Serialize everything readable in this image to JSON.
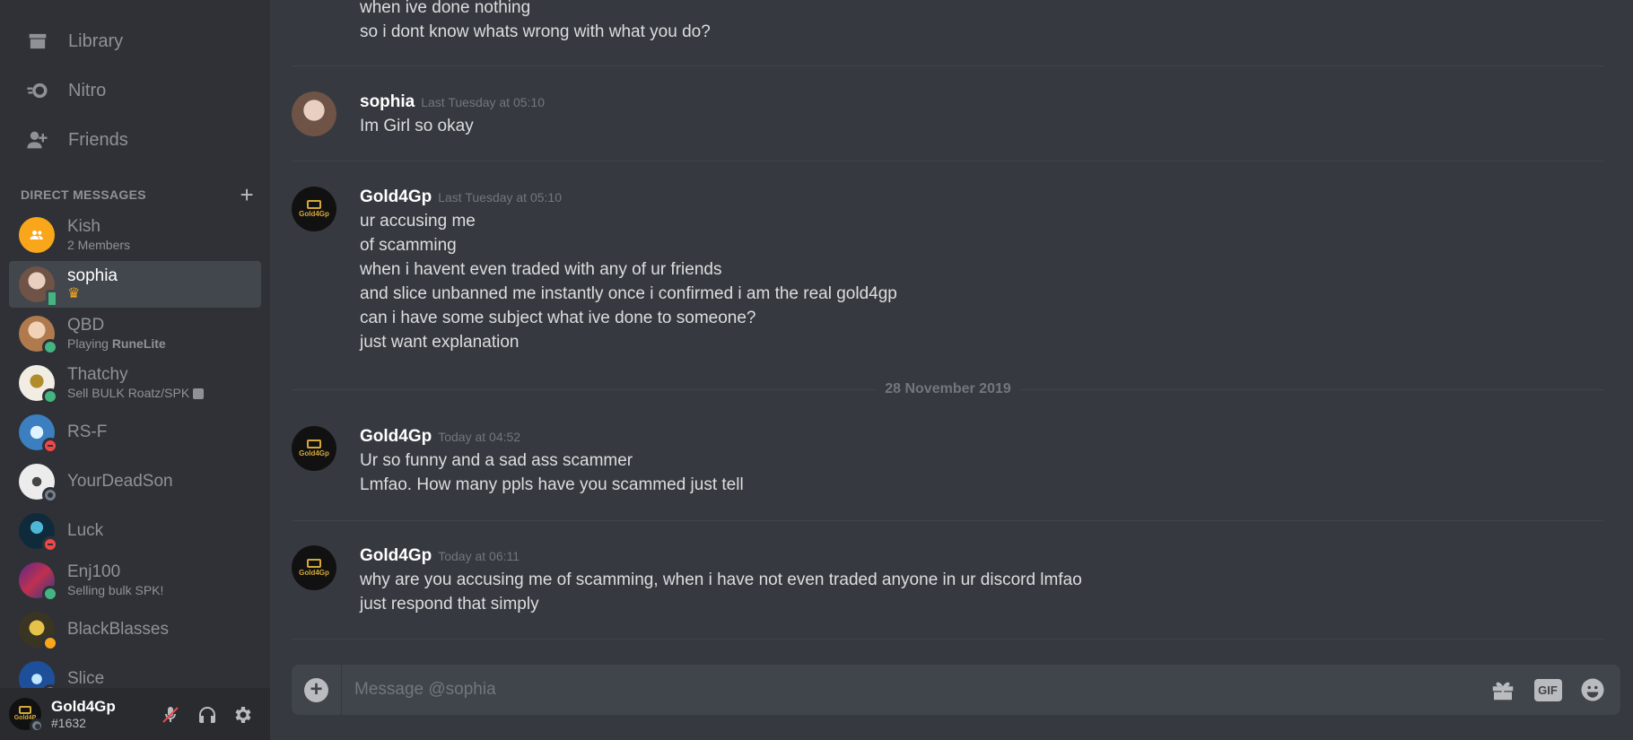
{
  "nav": {
    "library": "Library",
    "nitro": "Nitro",
    "friends": "Friends"
  },
  "dm_header": {
    "title": "DIRECT MESSAGES",
    "add": "+"
  },
  "dms": [
    {
      "name": "Kish",
      "sub": "2 Members",
      "status": "none",
      "avatar": "group-avatar",
      "color": "#faa61a"
    },
    {
      "name": "sophia",
      "sub": "",
      "status": "mobile",
      "avatar": "user-avatar",
      "color": "#8d7467",
      "badge": "crown-badge-icon"
    },
    {
      "name": "QBD",
      "sub_prefix": "Playing ",
      "sub_bold": "RuneLite",
      "status": "online",
      "avatar": "user-avatar",
      "color": "#c9976b"
    },
    {
      "name": "Thatchy",
      "sub": "Sell BULK Roatz/SPK",
      "status": "online",
      "avatar": "user-avatar",
      "color": "#e8e2cf"
    },
    {
      "name": "RS-F",
      "sub": "",
      "status": "dnd",
      "avatar": "user-avatar",
      "color": "#3b7fc0"
    },
    {
      "name": "YourDeadSon",
      "sub": "",
      "status": "offline",
      "avatar": "user-avatar",
      "color": "#d9d9d9"
    },
    {
      "name": "Luck",
      "sub": "",
      "status": "dnd",
      "avatar": "user-avatar",
      "color": "#1f4f66"
    },
    {
      "name": "Enj100",
      "sub": "Selling bulk SPK!",
      "status": "online",
      "avatar": "user-avatar",
      "color": "#a0365a"
    },
    {
      "name": "BlackBlasses",
      "sub": "",
      "status": "idle",
      "avatar": "user-avatar",
      "color": "#7a6a2a"
    },
    {
      "name": "Slice",
      "sub": "",
      "status": "offline",
      "avatar": "user-avatar",
      "color": "#2b68b8"
    }
  ],
  "user": {
    "name": "Gold4Gp",
    "tag": "#1632",
    "avatar_text": "Gold4P"
  },
  "messages": [
    {
      "author": "",
      "time": "",
      "lines": [
        "when ive done nothing",
        "so i dont know whats wrong with what you do?"
      ]
    },
    {
      "author": "sophia",
      "time": "Last Tuesday at 05:10",
      "lines": [
        "Im Girl so okay"
      ]
    },
    {
      "author": "Gold4Gp",
      "time": "Last Tuesday at 05:10",
      "lines": [
        "ur accusing me",
        "of scamming",
        "when i havent even traded with any of ur friends",
        "and slice unbanned me instantly once i confirmed i am the real gold4gp",
        "can i have some subject what ive done to someone?",
        "just want explanation"
      ]
    },
    {
      "author": "Gold4Gp",
      "time": "Today at 04:52",
      "lines": [
        "Ur so funny and a sad ass scammer",
        "Lmfao. How many ppls have you scammed just tell"
      ]
    },
    {
      "author": "Gold4Gp",
      "time": "Today at 06:11",
      "lines": [
        "why are you accusing me of scamming, when i have not even traded anyone in ur discord lmfao",
        "just respond that simply"
      ]
    }
  ],
  "date_separator": "28 November 2019",
  "gold_avatar_text": "Gold4Gp",
  "composer": {
    "placeholder": "Message @sophia",
    "gif_label": "GIF"
  },
  "colors": {
    "background": "#36393f",
    "sidebar": "#2f3136",
    "accent_gold": "#d4a93a"
  }
}
